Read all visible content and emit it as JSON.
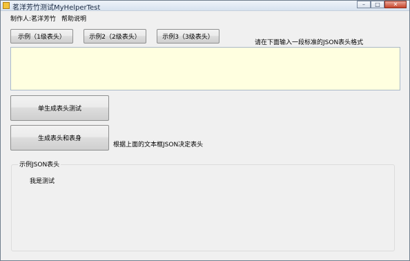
{
  "window": {
    "title": "茗洋芳竹测试MyHelperTest",
    "minimize": "–",
    "maximize": "□",
    "close": "✕"
  },
  "menu": {
    "items": [
      "制作人:茗洋芳竹",
      "帮助说明"
    ]
  },
  "buttons": {
    "example1": "示例（1级表头）",
    "example2": "示例2（2级表头）",
    "example3": "示例3（3级表头）",
    "single_header": "单生成表头测试",
    "header_body": "生成表头和表身"
  },
  "labels": {
    "json_prompt": "请在下面输入一段标准的JSON表头格式",
    "decide_hint": "根据上面的文本框JSON决定表头"
  },
  "json_input": {
    "value": ""
  },
  "example_group": {
    "title": "示例JSON表头",
    "content": "我是测试"
  }
}
